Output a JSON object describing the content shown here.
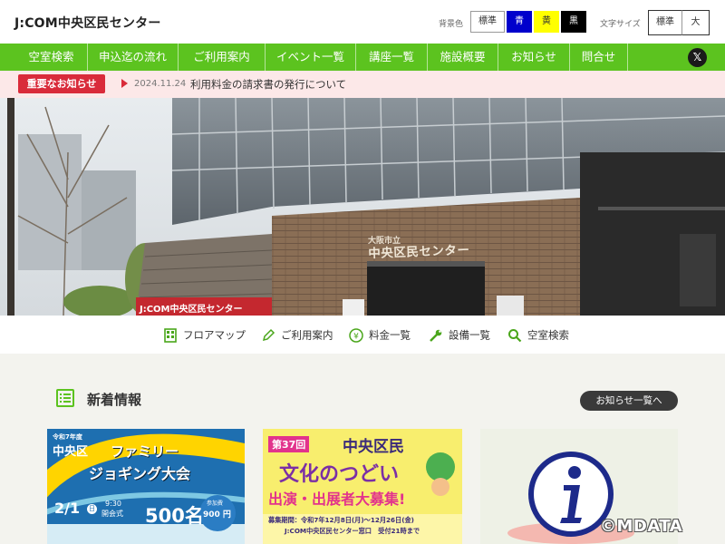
{
  "header": {
    "site_title": "J:COM中央区民センター",
    "bg_label": "背景色",
    "bg_options": [
      "標準",
      "青",
      "黄",
      "黒"
    ],
    "size_label": "文字サイズ",
    "size_options": [
      "標準",
      "大"
    ]
  },
  "nav": {
    "items": [
      "空室検索",
      "申込迄の流れ",
      "ご利用案内",
      "イベント一覧",
      "講座一覧",
      "施設概要",
      "お知らせ",
      "問合せ"
    ],
    "x_icon": "x-logo-icon"
  },
  "notice": {
    "badge": "重要なお知らせ",
    "date": "2024.11.24",
    "text": "利用料金の請求書の発行について"
  },
  "hero": {
    "sign_plate": "大阪市立",
    "sign_text": "中央区民センター",
    "banner_text": "J:COM中央区民センター"
  },
  "quick_links": [
    {
      "label": "フロアマップ",
      "icon": "floor-map-icon"
    },
    {
      "label": "ご利用案内",
      "icon": "pencil-icon"
    },
    {
      "label": "料金一覧",
      "icon": "yen-icon"
    },
    {
      "label": "設備一覧",
      "icon": "tool-icon"
    },
    {
      "label": "空室検索",
      "icon": "search-icon"
    }
  ],
  "news": {
    "title": "新着情報",
    "more_label": "お知らせ一覧へ",
    "cards": [
      {
        "year": "令和7年度",
        "area": "中央区",
        "title1": "ファミリー",
        "title2": "ジョギング大会",
        "date": "2/1",
        "day": "日",
        "open": "開会式",
        "time": "9:30",
        "capacity": "500名",
        "fee_label": "参加費",
        "fee": "900 円"
      },
      {
        "num": "第37回",
        "area": "中央区民",
        "title": "文化のつどい",
        "sub": "出演・出展者大募集!",
        "period": "募集期間：令和7年12月8日(月)～12月26日(金)",
        "place": "J:COM中央区民センター窓口　受付21時まで"
      },
      {
        "icon": "info-icon"
      }
    ]
  },
  "copyright": "©MDATA",
  "colors": {
    "nav_green": "#5cc31f",
    "notice_red": "#d92b3a",
    "notice_bg": "#fce8e8"
  }
}
